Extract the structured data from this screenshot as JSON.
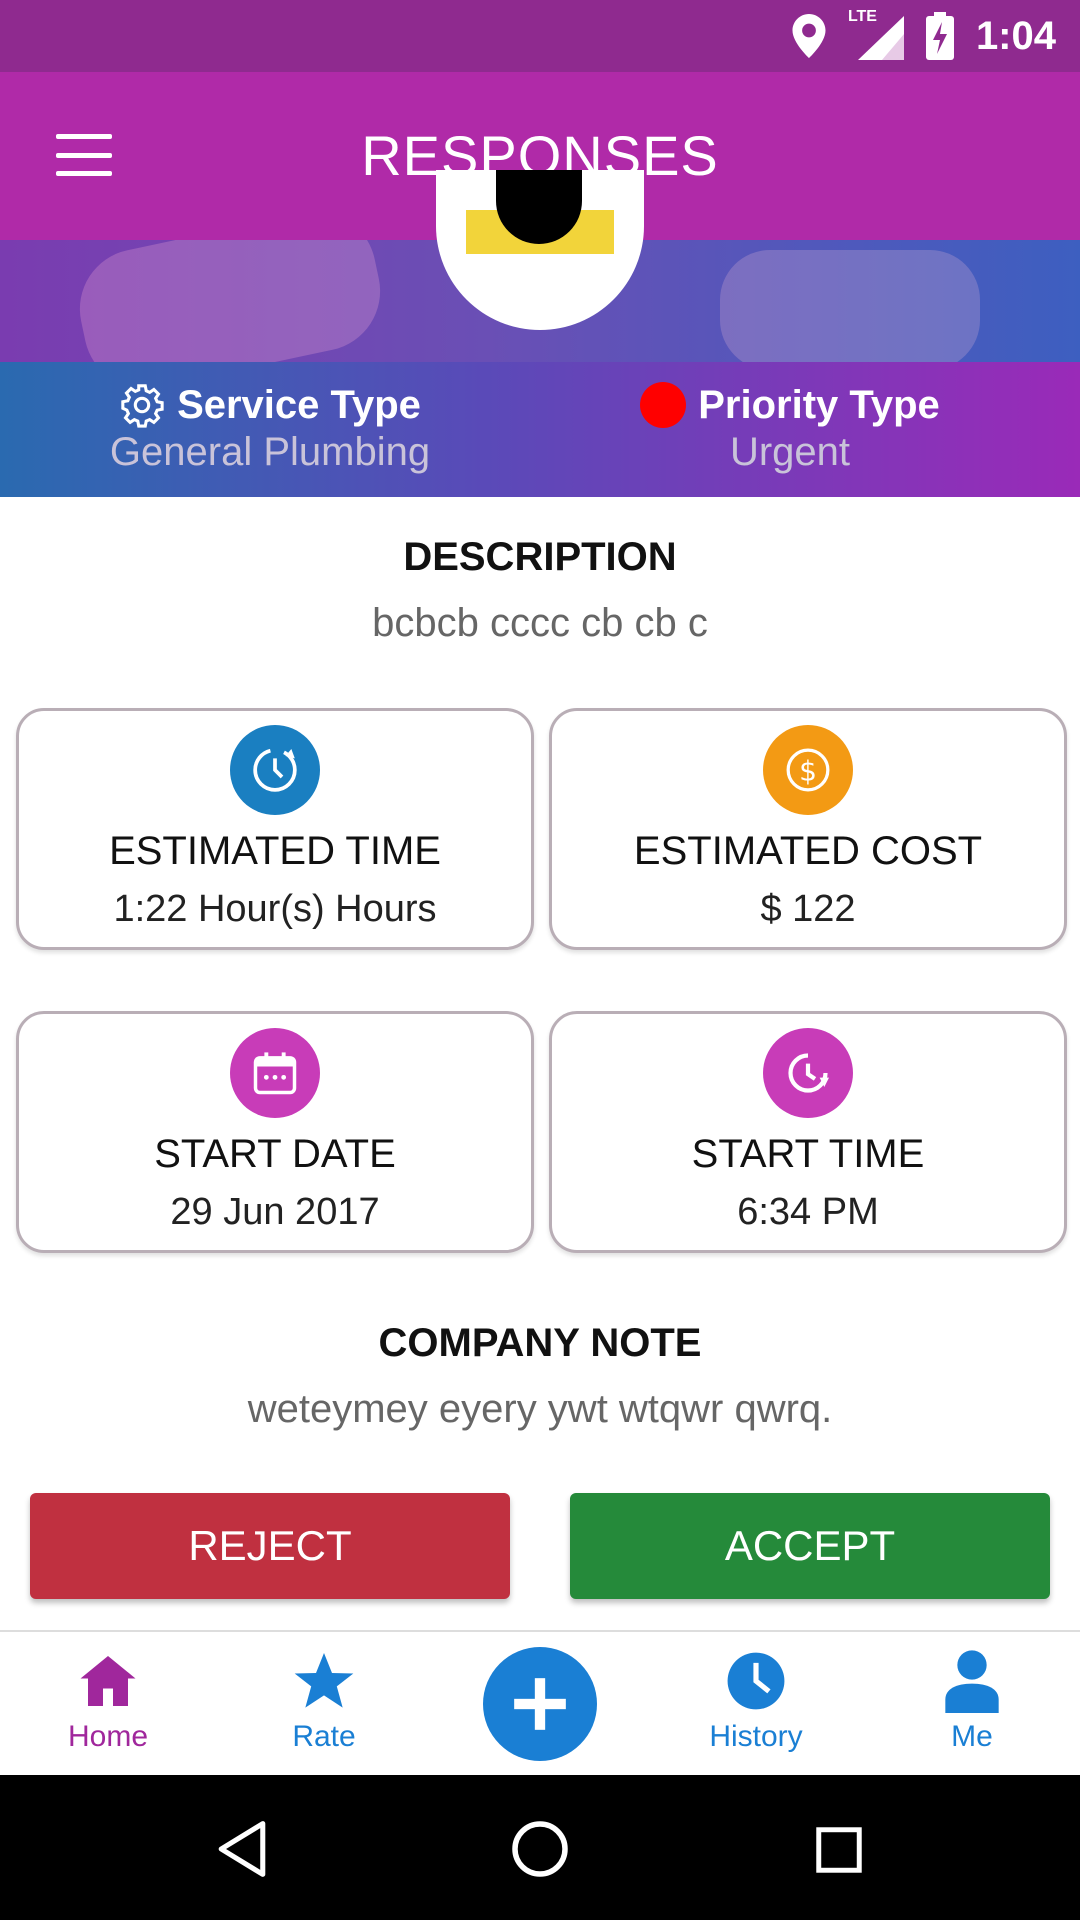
{
  "status_bar": {
    "network": "LTE",
    "time": "1:04"
  },
  "app_bar": {
    "title": "RESPONSES"
  },
  "service": {
    "service_type_label": "Service Type",
    "service_type_value": "General Plumbing",
    "priority_type_label": "Priority Type",
    "priority_type_value": "Urgent",
    "priority_color": "#ff0000"
  },
  "description": {
    "title": "DESCRIPTION",
    "text": "bcbcb cccc cb cb c"
  },
  "cards": [
    {
      "label": "ESTIMATED TIME",
      "value": "1:22 Hour(s) Hours",
      "icon": "clock-refresh-icon",
      "color": "#1a7fc1"
    },
    {
      "label": "ESTIMATED COST",
      "value": "$ 122",
      "icon": "dollar-icon",
      "color": "#f39a14"
    },
    {
      "label": "START DATE",
      "value": "29 Jun 2017",
      "icon": "calendar-icon",
      "color": "#c83cb8"
    },
    {
      "label": "START TIME",
      "value": "6:34 PM",
      "icon": "clock-icon",
      "color": "#c83cb8"
    }
  ],
  "company_note": {
    "title": "COMPANY NOTE",
    "text": "weteymey eyery ywt wtqwr qwrq."
  },
  "actions": {
    "reject": "REJECT",
    "accept": "ACCEPT"
  },
  "bottom_nav": {
    "home": "Home",
    "rate": "Rate",
    "history": "History",
    "me": "Me",
    "active_color": "#a0279c",
    "inactive_color": "#1a7fd4"
  }
}
